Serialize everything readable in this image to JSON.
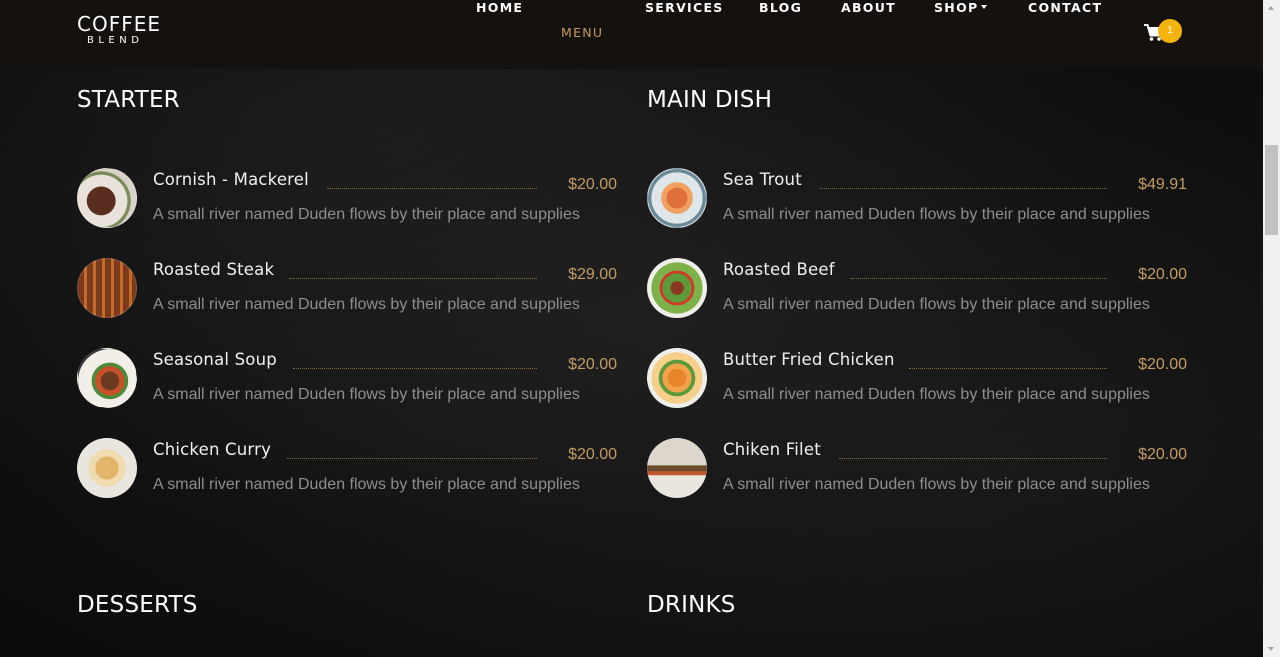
{
  "brand": {
    "top": "COFFEE",
    "bottom": "BLEND"
  },
  "nav": {
    "items": [
      "HOME",
      "MENU",
      "SERVICES",
      "BLOG",
      "ABOUT",
      "SHOP",
      "CONTACT"
    ],
    "active": "MENU",
    "cart_count": "1"
  },
  "colors": {
    "accent": "#c49b63",
    "badge": "#f5b40d",
    "navbar": "#15110f"
  },
  "sections": {
    "starter": {
      "title": "STARTER",
      "items": [
        {
          "name": "Cornish - Mackerel",
          "price": "$20.00",
          "desc": "A small river named Duden flows by their place and supplies",
          "icon": "steak-plate-image"
        },
        {
          "name": "Roasted Steak",
          "price": "$29.00",
          "desc": "A small river named Duden flows by their place and supplies",
          "icon": "ribs-image"
        },
        {
          "name": "Seasonal Soup",
          "price": "$20.00",
          "desc": "A small river named Duden flows by their place and supplies",
          "icon": "soup-plate-image"
        },
        {
          "name": "Chicken Curry",
          "price": "$20.00",
          "desc": "A small river named Duden flows by their place and supplies",
          "icon": "chicken-plate-image"
        }
      ]
    },
    "main": {
      "title": "MAIN DISH",
      "items": [
        {
          "name": "Sea Trout",
          "price": "$49.91",
          "desc": "A small river named Duden flows by their place and supplies",
          "icon": "shrimp-plate-image"
        },
        {
          "name": "Roasted Beef",
          "price": "$20.00",
          "desc": "A small river named Duden flows by their place and supplies",
          "icon": "salad-beef-image"
        },
        {
          "name": "Butter Fried Chicken",
          "price": "$20.00",
          "desc": "A small river named Duden flows by their place and supplies",
          "icon": "fried-chicken-image"
        },
        {
          "name": "Chiken Filet",
          "price": "$20.00",
          "desc": "A small river named Duden flows by their place and supplies",
          "icon": "filet-plate-image"
        }
      ]
    },
    "desserts": {
      "title": "DESSERTS"
    },
    "drinks": {
      "title": "DRINKS"
    }
  }
}
